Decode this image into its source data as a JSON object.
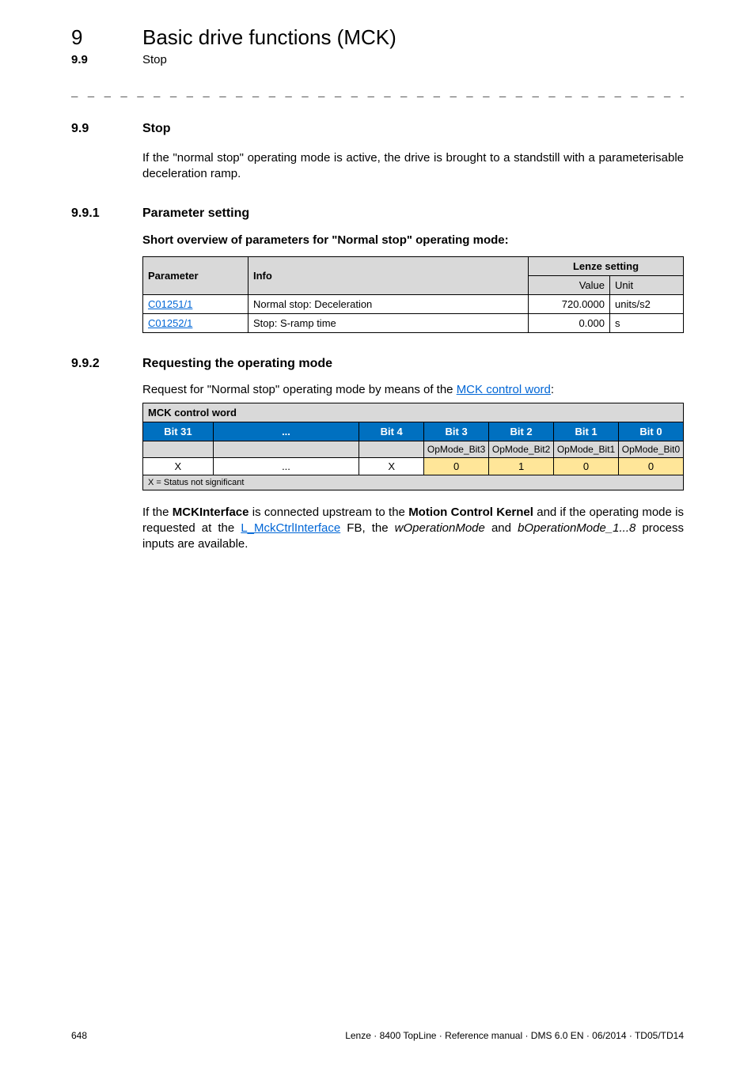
{
  "header": {
    "chapter_num": "9",
    "chapter_title": "Basic drive functions (MCK)",
    "sub_num": "9.9",
    "sub_title": "Stop"
  },
  "dashline": "_ _ _ _ _ _ _ _ _ _ _ _ _ _ _ _ _ _ _ _ _ _ _ _ _ _ _ _ _ _ _ _ _ _ _ _ _ _ _ _ _ _ _ _ _ _ _ _ _ _ _ _ _ _ _ _ _ _ _ _ _ _ _ _",
  "sec99": {
    "num": "9.9",
    "title": "Stop",
    "para": "If the \"normal stop\" operating mode is active, the drive is brought to a standstill with a parameterisable deceleration ramp."
  },
  "sec991": {
    "num": "9.9.1",
    "title": "Parameter setting",
    "sub": "Short overview of parameters for \"Normal stop\" operating mode:",
    "table": {
      "h_param": "Parameter",
      "h_info": "Info",
      "h_lenze": "Lenze setting",
      "h_value": "Value",
      "h_unit": "Unit",
      "rows": [
        {
          "param": "C01251/1",
          "info": "Normal stop: Deceleration",
          "value": "720.0000",
          "unit": "units/s2"
        },
        {
          "param": "C01252/1",
          "info": "Stop: S-ramp time",
          "value": "0.000",
          "unit": "s"
        }
      ]
    }
  },
  "sec992": {
    "num": "9.9.2",
    "title": "Requesting the operating mode",
    "para_pre": "Request for \"Normal stop\" operating mode by means of the ",
    "para_link": "MCK control word",
    "para_post": ":",
    "mck": {
      "title": "MCK control word",
      "bits": [
        "Bit 31",
        "...",
        "Bit 4",
        "Bit 3",
        "Bit 2",
        "Bit 1",
        "Bit 0"
      ],
      "sub": [
        "",
        "",
        "",
        "OpMode_Bit3",
        "OpMode_Bit2",
        "OpMode_Bit1",
        "OpMode_Bit0"
      ],
      "vals": [
        "X",
        "...",
        "X",
        "0",
        "1",
        "0",
        "0"
      ],
      "foot": "X = Status not significant"
    },
    "p2": {
      "s1": "If the ",
      "b1": "MCKInterface",
      "s2": " is connected upstream to the ",
      "b2": "Motion Control Kernel",
      "s3": " and if the operating mode is requested at the ",
      "link": "L_MckCtrlInterface",
      "s4": " FB, the ",
      "i1": "wOperationMode",
      "s5": " and ",
      "i2": "bOperationMode_1...8",
      "s6": " process inputs are available."
    }
  },
  "footer": {
    "page": "648",
    "right": "Lenze · 8400 TopLine · Reference manual · DMS 6.0 EN · 06/2014 · TD05/TD14"
  }
}
